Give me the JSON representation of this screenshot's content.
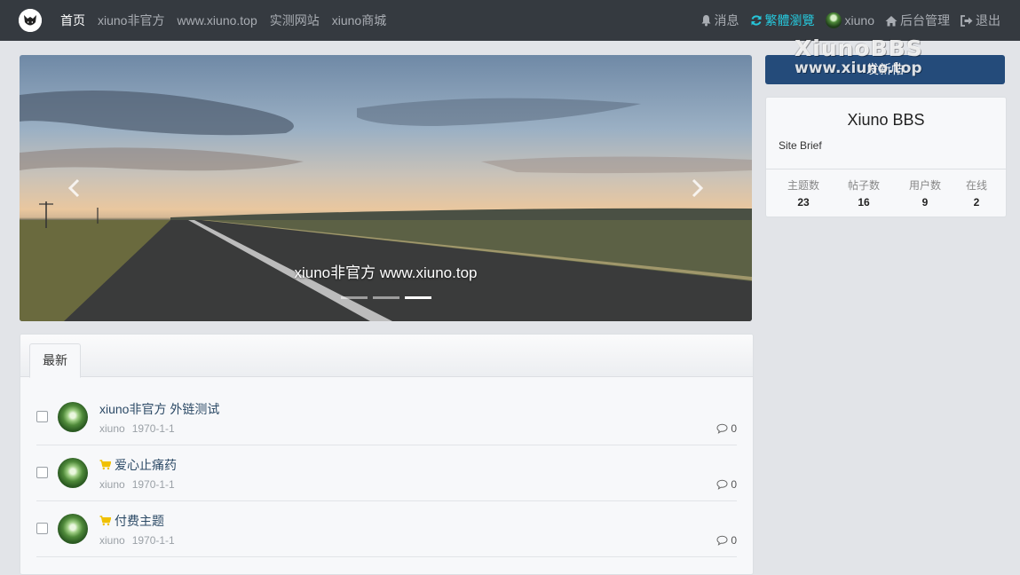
{
  "nav": {
    "left": [
      {
        "label": "首页",
        "active": true
      },
      {
        "label": "xiuno非官方"
      },
      {
        "label": "www.xiuno.top"
      },
      {
        "label": "实测网站"
      },
      {
        "label": "xiuno商城"
      }
    ],
    "right": [
      {
        "label": "消息",
        "icon": "bell-icon"
      },
      {
        "label": "繁體瀏覽",
        "icon": "refresh-icon",
        "highlight": true
      },
      {
        "label": "xiuno",
        "icon": "avatar"
      },
      {
        "label": "后台管理",
        "icon": "home-icon"
      },
      {
        "label": "退出",
        "icon": "logout-icon"
      }
    ]
  },
  "carousel": {
    "caption": "xiuno非官方 www.xiuno.top",
    "slide_count": 3,
    "active_slide": 3
  },
  "threads_card": {
    "tab_label": "最新",
    "threads": [
      {
        "title": "xiuno非官方 外链测试",
        "author": "xiuno",
        "date": "1970-1-1",
        "replies": "0",
        "paid": false
      },
      {
        "title": "爱心止痛药",
        "author": "xiuno",
        "date": "1970-1-1",
        "replies": "0",
        "paid": true
      },
      {
        "title": "付费主题",
        "author": "xiuno",
        "date": "1970-1-1",
        "replies": "0",
        "paid": true
      }
    ]
  },
  "sidebar": {
    "new_thread_label": "发新帖",
    "watermark_line1": "XiunoBBS",
    "watermark_line2": "www.xiuno.top",
    "site_name": "Xiuno BBS",
    "site_brief": "Site Brief",
    "stats": [
      {
        "label": "主题数",
        "value": "23"
      },
      {
        "label": "帖子数",
        "value": "16"
      },
      {
        "label": "用户数",
        "value": "9"
      },
      {
        "label": "在线",
        "value": "2"
      }
    ]
  },
  "colors": {
    "navbar_bg": "#353a40",
    "accent_cyan": "#26c6da",
    "primary_button": "#244b7a",
    "cart_icon": "#f0c000"
  }
}
